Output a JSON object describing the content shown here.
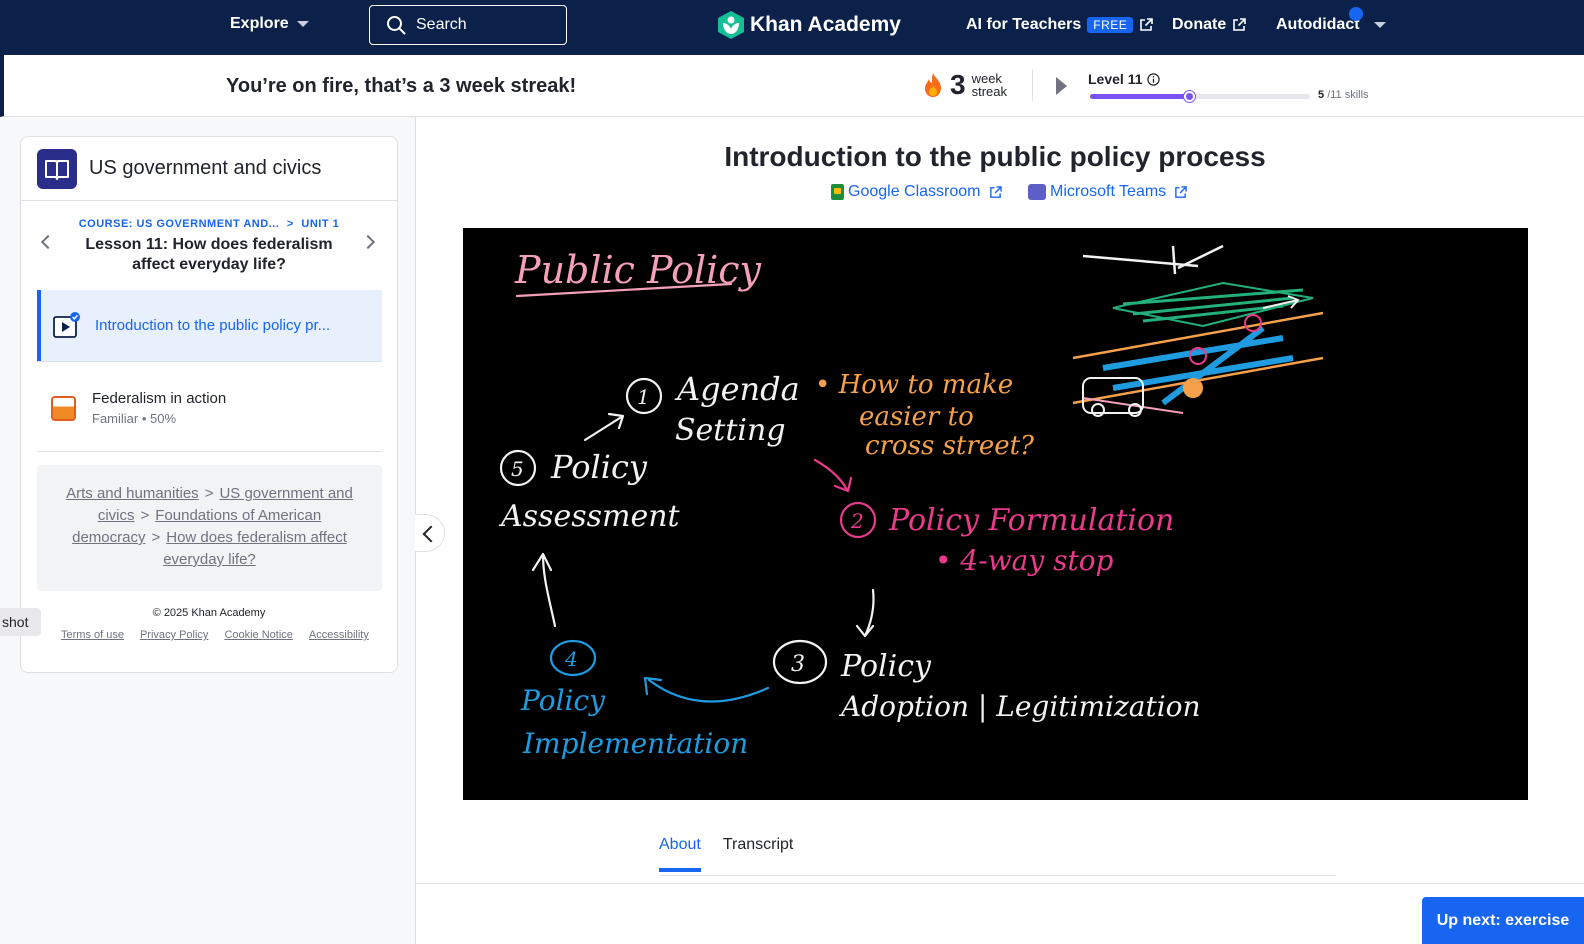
{
  "nav": {
    "explore_label": "Explore",
    "search_placeholder": "Search",
    "logo_text": "Khan Academy",
    "ai_teachers_label": "AI for Teachers",
    "free_badge": "FREE",
    "donate_label": "Donate",
    "user_label": "Autodidact"
  },
  "streak": {
    "message": "You’re on fire, that’s a 3 week streak!",
    "count": "3",
    "unit_top": "week",
    "unit_bottom": "streak",
    "level_label": "Level 11",
    "skills_done": "5",
    "skills_total": "/11 skills",
    "progress_fraction": 0.45
  },
  "sidebar": {
    "course_title": "US government and civics",
    "crumb_course": "COURSE: US GOVERNMENT AND...",
    "crumb_sep": ">",
    "crumb_unit": "UNIT 1",
    "lesson_title": "Lesson 11: How does federalism affect everyday life?",
    "items": [
      {
        "label": "Introduction to the public policy pr...",
        "type": "video",
        "active": true
      },
      {
        "label": "Federalism in action",
        "sub": "Familiar • 50%",
        "type": "exercise"
      }
    ],
    "path": {
      "part1": "Arts and humanities",
      "part2": "US government and civics",
      "part3": "Foundations of American democracy",
      "part4": "How does federalism affect everyday life?",
      "sep": ">"
    },
    "copyright": "© 2025 Khan Academy",
    "footer": {
      "terms": "Terms of use",
      "privacy": "Privacy Policy",
      "cookie": "Cookie Notice",
      "accessibility": "Accessibility"
    },
    "shot_label": "shot"
  },
  "main": {
    "title": "Introduction to the public policy process",
    "google_classroom": "Google Classroom",
    "microsoft_teams": "Microsoft Teams",
    "tabs": {
      "about": "About",
      "transcript": "Transcript"
    },
    "up_next": "Up next: exercise"
  },
  "video_board": {
    "heading": "Public Policy",
    "step1_num": "1",
    "step1_line1": "Agenda",
    "step1_line2": "Setting",
    "question_line1": "• How to make",
    "question_line2": "easier to",
    "question_line3": "cross street?",
    "step2_num": "2",
    "step2_text": "Policy Formulation",
    "step2_bullet": "• 4-way stop",
    "step3_num": "3",
    "step3_line1": "Policy",
    "step3_line2": "Adoption | Legitimization",
    "step4_num": "4",
    "step4_line1": "Policy",
    "step4_line2": "Implementation",
    "step5_num": "5",
    "step5_line1": "Policy",
    "step5_line2": "Assessment"
  },
  "colors": {
    "nav_bg": "#0b2149",
    "accent_blue": "#1865f2",
    "level_purple": "#7854f7",
    "board_pink": "#f4a0b8",
    "board_orange": "#f5a04a",
    "board_magenta": "#ea3a8c",
    "board_blue": "#1f9be0",
    "board_white": "#f2f2f2"
  },
  "icons": {
    "search": "search-icon",
    "logo": "khan-logo-icon",
    "external": "external-link-icon",
    "flame": "flame-icon",
    "info": "info-icon",
    "book": "book-icon",
    "video": "video-play-icon"
  }
}
